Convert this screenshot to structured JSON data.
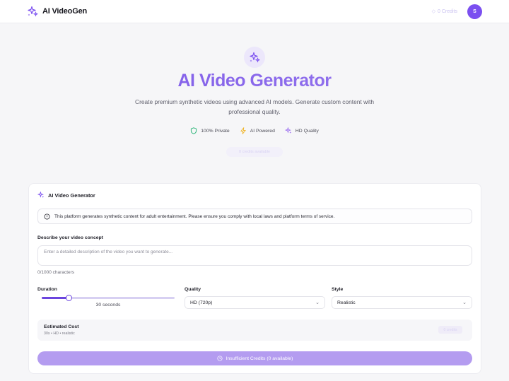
{
  "header": {
    "brand_name": "AI VideoGen",
    "credits_label": "0 Credits",
    "avatar_initial": "S"
  },
  "hero": {
    "title": "AI Video Generator",
    "subtitle": "Create premium synthetic videos using advanced AI models. Generate custom content with professional quality.",
    "features": [
      {
        "label": "100% Private",
        "icon": "shield-icon",
        "color": "#2fb67a"
      },
      {
        "label": "AI Powered",
        "icon": "bolt-icon",
        "color": "#f0b323"
      },
      {
        "label": "HD Quality",
        "icon": "sparkle-icon",
        "color": "#9b6cf0"
      }
    ],
    "ghost_pill_label": "0 credits available"
  },
  "card": {
    "title": "AI Video Generator",
    "notice": "This platform generates synthetic content for adult entertainment. Please ensure you comply with local laws and platform terms of service.",
    "prompt": {
      "label": "Describe your video concept",
      "placeholder": "Enter a detailed description of the video you want to generate...",
      "char_count": "0/1000 characters"
    },
    "duration": {
      "label": "Duration",
      "value_label": "30 seconds",
      "fraction": 0.2
    },
    "quality": {
      "label": "Quality",
      "selected": "HD (720p)"
    },
    "style": {
      "label": "Style",
      "selected": "Realistic"
    },
    "cost": {
      "title": "Estimated Cost",
      "detail": "30s • HD • realistic",
      "value": "0 credits"
    },
    "generate_button": "Insufficient Credits (0 available)"
  },
  "colors": {
    "accent": "#7b4ff0",
    "button_disabled": "#b49cf0"
  }
}
